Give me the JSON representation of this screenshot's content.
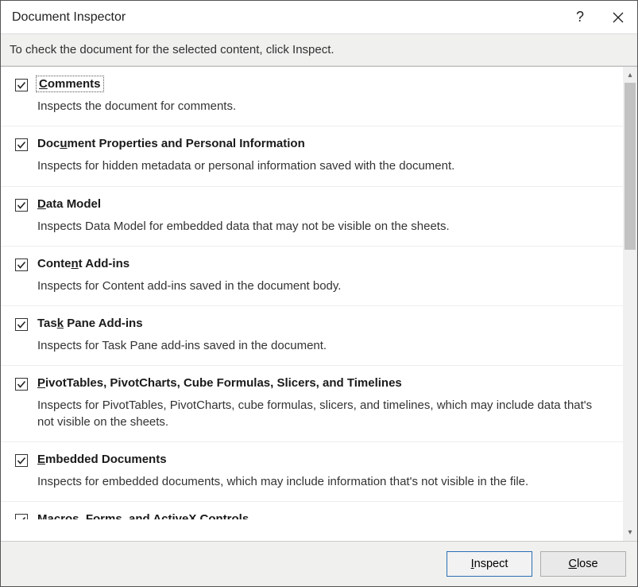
{
  "titlebar": {
    "title": "Document Inspector",
    "help_symbol": "?"
  },
  "instruction": "To check the document for the selected content, click Inspect.",
  "items": [
    {
      "checked": true,
      "focused": true,
      "title_pre": "",
      "title_accel": "C",
      "title_post": "omments",
      "desc": "Inspects the document for comments."
    },
    {
      "checked": true,
      "title_pre": "Doc",
      "title_accel": "u",
      "title_post": "ment Properties and Personal Information",
      "desc": "Inspects for hidden metadata or personal information saved with the document."
    },
    {
      "checked": true,
      "title_pre": "",
      "title_accel": "D",
      "title_post": "ata Model",
      "desc": "Inspects Data Model for embedded data that may not be visible on the sheets."
    },
    {
      "checked": true,
      "title_pre": "Conte",
      "title_accel": "n",
      "title_post": "t Add-ins",
      "desc": "Inspects for Content add-ins saved in the document body."
    },
    {
      "checked": true,
      "title_pre": "Tas",
      "title_accel": "k",
      "title_post": " Pane Add-ins",
      "desc": "Inspects for Task Pane add-ins saved in the document."
    },
    {
      "checked": true,
      "title_pre": "",
      "title_accel": "P",
      "title_post": "ivotTables, PivotCharts, Cube Formulas, Slicers, and Timelines",
      "desc": "Inspects for PivotTables, PivotCharts, cube formulas, slicers, and timelines, which may include data that's not visible on the sheets."
    },
    {
      "checked": true,
      "title_pre": "",
      "title_accel": "E",
      "title_post": "mbedded Documents",
      "desc": "Inspects for embedded documents, which may include information that's not visible in the file."
    },
    {
      "checked": true,
      "cut": true,
      "title_pre": "Macros, Forms, and Active",
      "title_accel": "X",
      "title_post": " Controls",
      "desc": ""
    }
  ],
  "footer": {
    "inspect_pre": "",
    "inspect_accel": "I",
    "inspect_post": "nspect",
    "close_pre": "",
    "close_accel": "C",
    "close_post": "lose"
  }
}
